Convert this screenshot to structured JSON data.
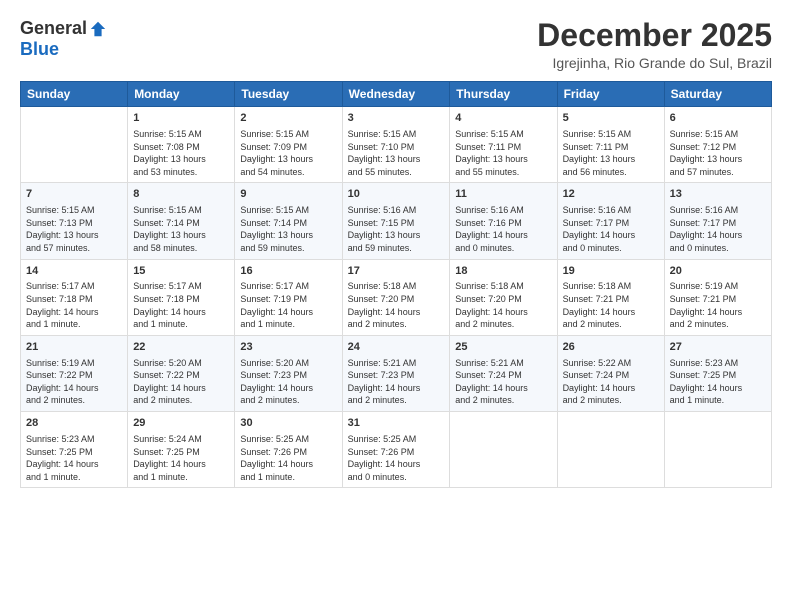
{
  "header": {
    "logo_general": "General",
    "logo_blue": "Blue",
    "month_title": "December 2025",
    "location": "Igrejinha, Rio Grande do Sul, Brazil"
  },
  "weekdays": [
    "Sunday",
    "Monday",
    "Tuesday",
    "Wednesday",
    "Thursday",
    "Friday",
    "Saturday"
  ],
  "weeks": [
    [
      {
        "day": "",
        "content": ""
      },
      {
        "day": "1",
        "content": "Sunrise: 5:15 AM\nSunset: 7:08 PM\nDaylight: 13 hours\nand 53 minutes."
      },
      {
        "day": "2",
        "content": "Sunrise: 5:15 AM\nSunset: 7:09 PM\nDaylight: 13 hours\nand 54 minutes."
      },
      {
        "day": "3",
        "content": "Sunrise: 5:15 AM\nSunset: 7:10 PM\nDaylight: 13 hours\nand 55 minutes."
      },
      {
        "day": "4",
        "content": "Sunrise: 5:15 AM\nSunset: 7:11 PM\nDaylight: 13 hours\nand 55 minutes."
      },
      {
        "day": "5",
        "content": "Sunrise: 5:15 AM\nSunset: 7:11 PM\nDaylight: 13 hours\nand 56 minutes."
      },
      {
        "day": "6",
        "content": "Sunrise: 5:15 AM\nSunset: 7:12 PM\nDaylight: 13 hours\nand 57 minutes."
      }
    ],
    [
      {
        "day": "7",
        "content": "Sunrise: 5:15 AM\nSunset: 7:13 PM\nDaylight: 13 hours\nand 57 minutes."
      },
      {
        "day": "8",
        "content": "Sunrise: 5:15 AM\nSunset: 7:14 PM\nDaylight: 13 hours\nand 58 minutes."
      },
      {
        "day": "9",
        "content": "Sunrise: 5:15 AM\nSunset: 7:14 PM\nDaylight: 13 hours\nand 59 minutes."
      },
      {
        "day": "10",
        "content": "Sunrise: 5:16 AM\nSunset: 7:15 PM\nDaylight: 13 hours\nand 59 minutes."
      },
      {
        "day": "11",
        "content": "Sunrise: 5:16 AM\nSunset: 7:16 PM\nDaylight: 14 hours\nand 0 minutes."
      },
      {
        "day": "12",
        "content": "Sunrise: 5:16 AM\nSunset: 7:17 PM\nDaylight: 14 hours\nand 0 minutes."
      },
      {
        "day": "13",
        "content": "Sunrise: 5:16 AM\nSunset: 7:17 PM\nDaylight: 14 hours\nand 0 minutes."
      }
    ],
    [
      {
        "day": "14",
        "content": "Sunrise: 5:17 AM\nSunset: 7:18 PM\nDaylight: 14 hours\nand 1 minute."
      },
      {
        "day": "15",
        "content": "Sunrise: 5:17 AM\nSunset: 7:18 PM\nDaylight: 14 hours\nand 1 minute."
      },
      {
        "day": "16",
        "content": "Sunrise: 5:17 AM\nSunset: 7:19 PM\nDaylight: 14 hours\nand 1 minute."
      },
      {
        "day": "17",
        "content": "Sunrise: 5:18 AM\nSunset: 7:20 PM\nDaylight: 14 hours\nand 2 minutes."
      },
      {
        "day": "18",
        "content": "Sunrise: 5:18 AM\nSunset: 7:20 PM\nDaylight: 14 hours\nand 2 minutes."
      },
      {
        "day": "19",
        "content": "Sunrise: 5:18 AM\nSunset: 7:21 PM\nDaylight: 14 hours\nand 2 minutes."
      },
      {
        "day": "20",
        "content": "Sunrise: 5:19 AM\nSunset: 7:21 PM\nDaylight: 14 hours\nand 2 minutes."
      }
    ],
    [
      {
        "day": "21",
        "content": "Sunrise: 5:19 AM\nSunset: 7:22 PM\nDaylight: 14 hours\nand 2 minutes."
      },
      {
        "day": "22",
        "content": "Sunrise: 5:20 AM\nSunset: 7:22 PM\nDaylight: 14 hours\nand 2 minutes."
      },
      {
        "day": "23",
        "content": "Sunrise: 5:20 AM\nSunset: 7:23 PM\nDaylight: 14 hours\nand 2 minutes."
      },
      {
        "day": "24",
        "content": "Sunrise: 5:21 AM\nSunset: 7:23 PM\nDaylight: 14 hours\nand 2 minutes."
      },
      {
        "day": "25",
        "content": "Sunrise: 5:21 AM\nSunset: 7:24 PM\nDaylight: 14 hours\nand 2 minutes."
      },
      {
        "day": "26",
        "content": "Sunrise: 5:22 AM\nSunset: 7:24 PM\nDaylight: 14 hours\nand 2 minutes."
      },
      {
        "day": "27",
        "content": "Sunrise: 5:23 AM\nSunset: 7:25 PM\nDaylight: 14 hours\nand 1 minute."
      }
    ],
    [
      {
        "day": "28",
        "content": "Sunrise: 5:23 AM\nSunset: 7:25 PM\nDaylight: 14 hours\nand 1 minute."
      },
      {
        "day": "29",
        "content": "Sunrise: 5:24 AM\nSunset: 7:25 PM\nDaylight: 14 hours\nand 1 minute."
      },
      {
        "day": "30",
        "content": "Sunrise: 5:25 AM\nSunset: 7:26 PM\nDaylight: 14 hours\nand 1 minute."
      },
      {
        "day": "31",
        "content": "Sunrise: 5:25 AM\nSunset: 7:26 PM\nDaylight: 14 hours\nand 0 minutes."
      },
      {
        "day": "",
        "content": ""
      },
      {
        "day": "",
        "content": ""
      },
      {
        "day": "",
        "content": ""
      }
    ]
  ]
}
